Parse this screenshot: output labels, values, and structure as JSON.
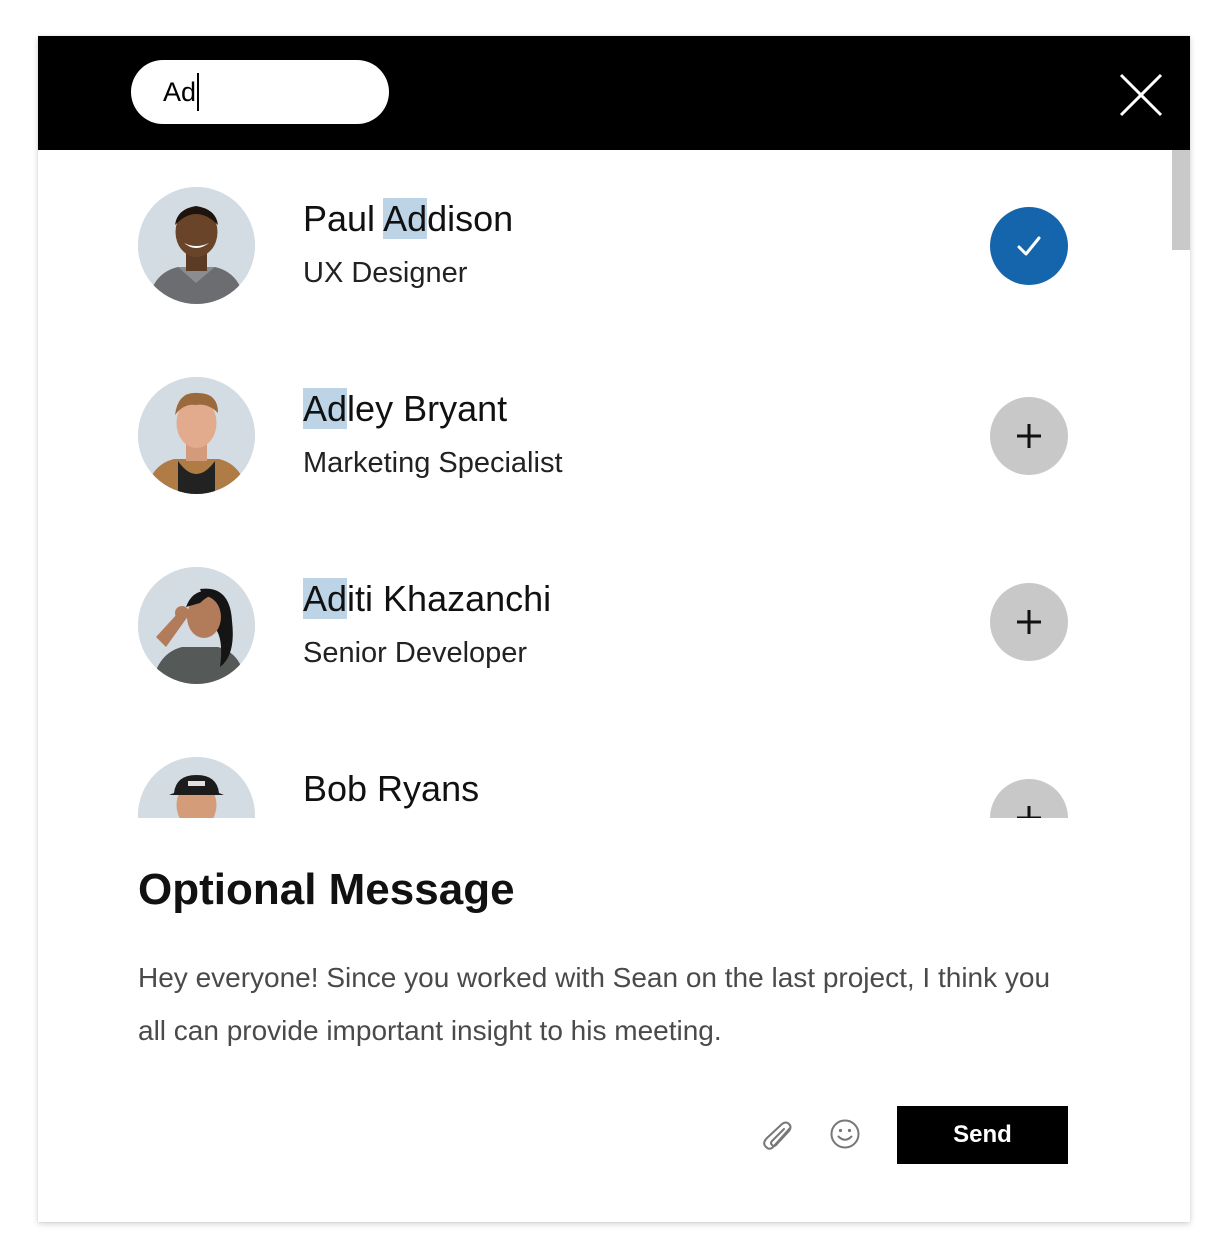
{
  "search": {
    "value": "Ad"
  },
  "people": [
    {
      "name_highlight_before": "Paul ",
      "name_highlight": "Ad",
      "name_highlight_after": "dison",
      "role": "UX Designer",
      "status": "added"
    },
    {
      "name_highlight_before": "",
      "name_highlight": "Ad",
      "name_highlight_after": "ley Bryant",
      "role": "Marketing Specialist",
      "status": "add"
    },
    {
      "name_highlight_before": "",
      "name_highlight": "Ad",
      "name_highlight_after": "iti Khazanchi",
      "role": "Senior Developer",
      "status": "add"
    },
    {
      "name_highlight_before": "Bob Ryans",
      "name_highlight": "",
      "name_highlight_after": "",
      "role": "",
      "status": "add"
    }
  ],
  "icons": {
    "close": "close-icon",
    "added": "check-icon",
    "add": "plus-icon",
    "attach": "paperclip-icon",
    "emoji": "smiley-icon"
  },
  "colors": {
    "topbar": "#000000",
    "added_button": "#1565ad",
    "add_button": "#c8c8c8",
    "highlight": "#bcd4e6",
    "send_button": "#000000"
  },
  "optional_message": {
    "title": "Optional Message",
    "text": "Hey everyone! Since you worked with Sean on the last project, I think you all can provide important insight to his meeting."
  },
  "send_label": "Send"
}
